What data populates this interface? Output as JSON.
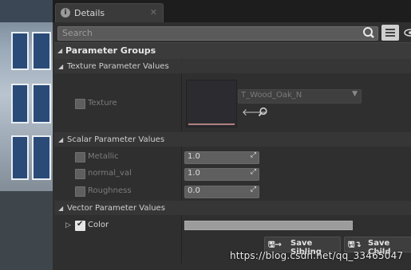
{
  "tab": {
    "title": "Details"
  },
  "search": {
    "placeholder": "Search"
  },
  "parameter_groups": {
    "title": "Parameter Groups",
    "texture_section": {
      "title": "Texture Parameter Values",
      "param_label": "Texture",
      "asset_name": "T_Wood_Oak_N"
    },
    "scalar_section": {
      "title": "Scalar Parameter Values",
      "params": [
        {
          "label": "Metallic",
          "value": "1.0"
        },
        {
          "label": "normal_val",
          "value": "1.0"
        },
        {
          "label": "Roughness",
          "value": "0.0"
        }
      ]
    },
    "vector_section": {
      "title": "Vector Parameter Values",
      "param_label": "Color"
    }
  },
  "buttons": {
    "save_sibling": "Save Sibling",
    "save_child": "Save Child"
  },
  "watermark": "https://blog.csdn.net/qq_33465047",
  "colors": {
    "panel": "#2f2f2f",
    "header": "#3b3b3b",
    "field": "#5f5f5f"
  }
}
